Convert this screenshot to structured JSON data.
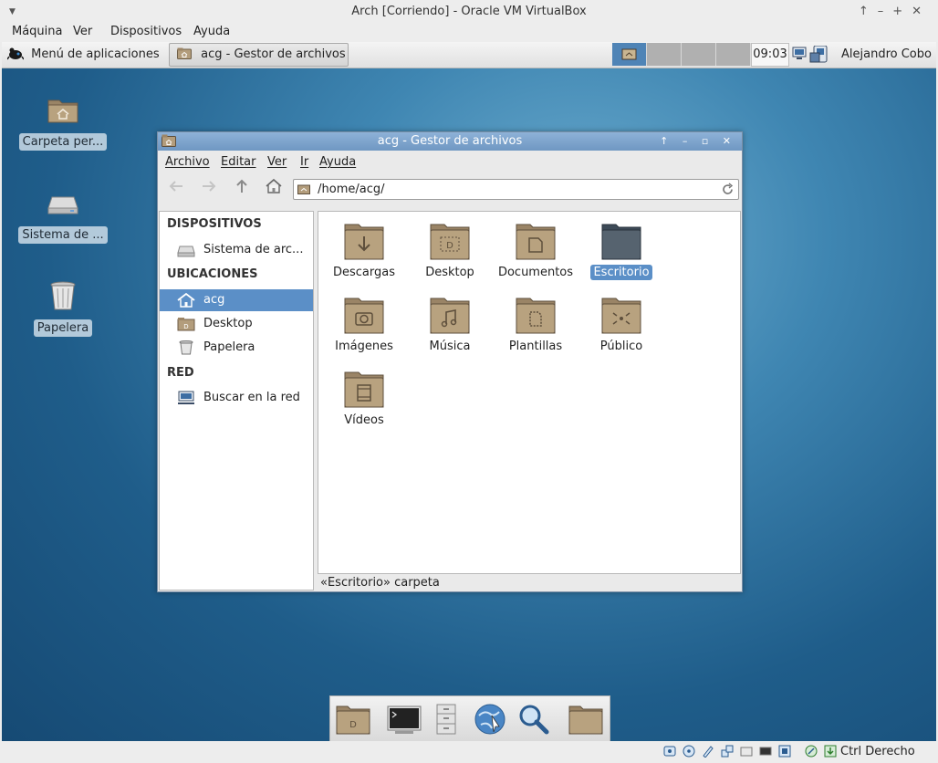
{
  "host": {
    "title": "Arch [Corriendo] - Oracle VM VirtualBox",
    "menu": [
      "Máquina",
      "Ver",
      "Dispositivos",
      "Ayuda"
    ],
    "host_key": "Ctrl Derecho"
  },
  "panel": {
    "apps_menu": "Menú de aplicaciones",
    "task": "acg - Gestor de archivos",
    "clock": "09:03",
    "user": "Alejandro Cobo"
  },
  "desktop": {
    "icons": [
      {
        "label": "Carpeta per..."
      },
      {
        "label": "Sistema de ..."
      },
      {
        "label": "Papelera"
      }
    ]
  },
  "filemanager": {
    "title": "acg - Gestor de archivos",
    "menu": [
      "Archivo",
      "Editar",
      "Ver",
      "Ir",
      "Ayuda"
    ],
    "location": "/home/acg/",
    "sidebar": {
      "devices_header": "DISPOSITIVOS",
      "device": "Sistema de arc...",
      "places_header": "UBICACIONES",
      "places": [
        "acg",
        "Desktop",
        "Papelera"
      ],
      "network_header": "RED",
      "network": "Buscar en la red"
    },
    "folders": [
      "Descargas",
      "Desktop",
      "Documentos",
      "Escritorio",
      "Imágenes",
      "Música",
      "Plantillas",
      "Público",
      "Vídeos"
    ],
    "status": "«Escritorio» carpeta"
  },
  "colors": {
    "selection": "#5b8fc7",
    "folder": "#b39d7c",
    "titlebar": "#7ea5cd"
  }
}
